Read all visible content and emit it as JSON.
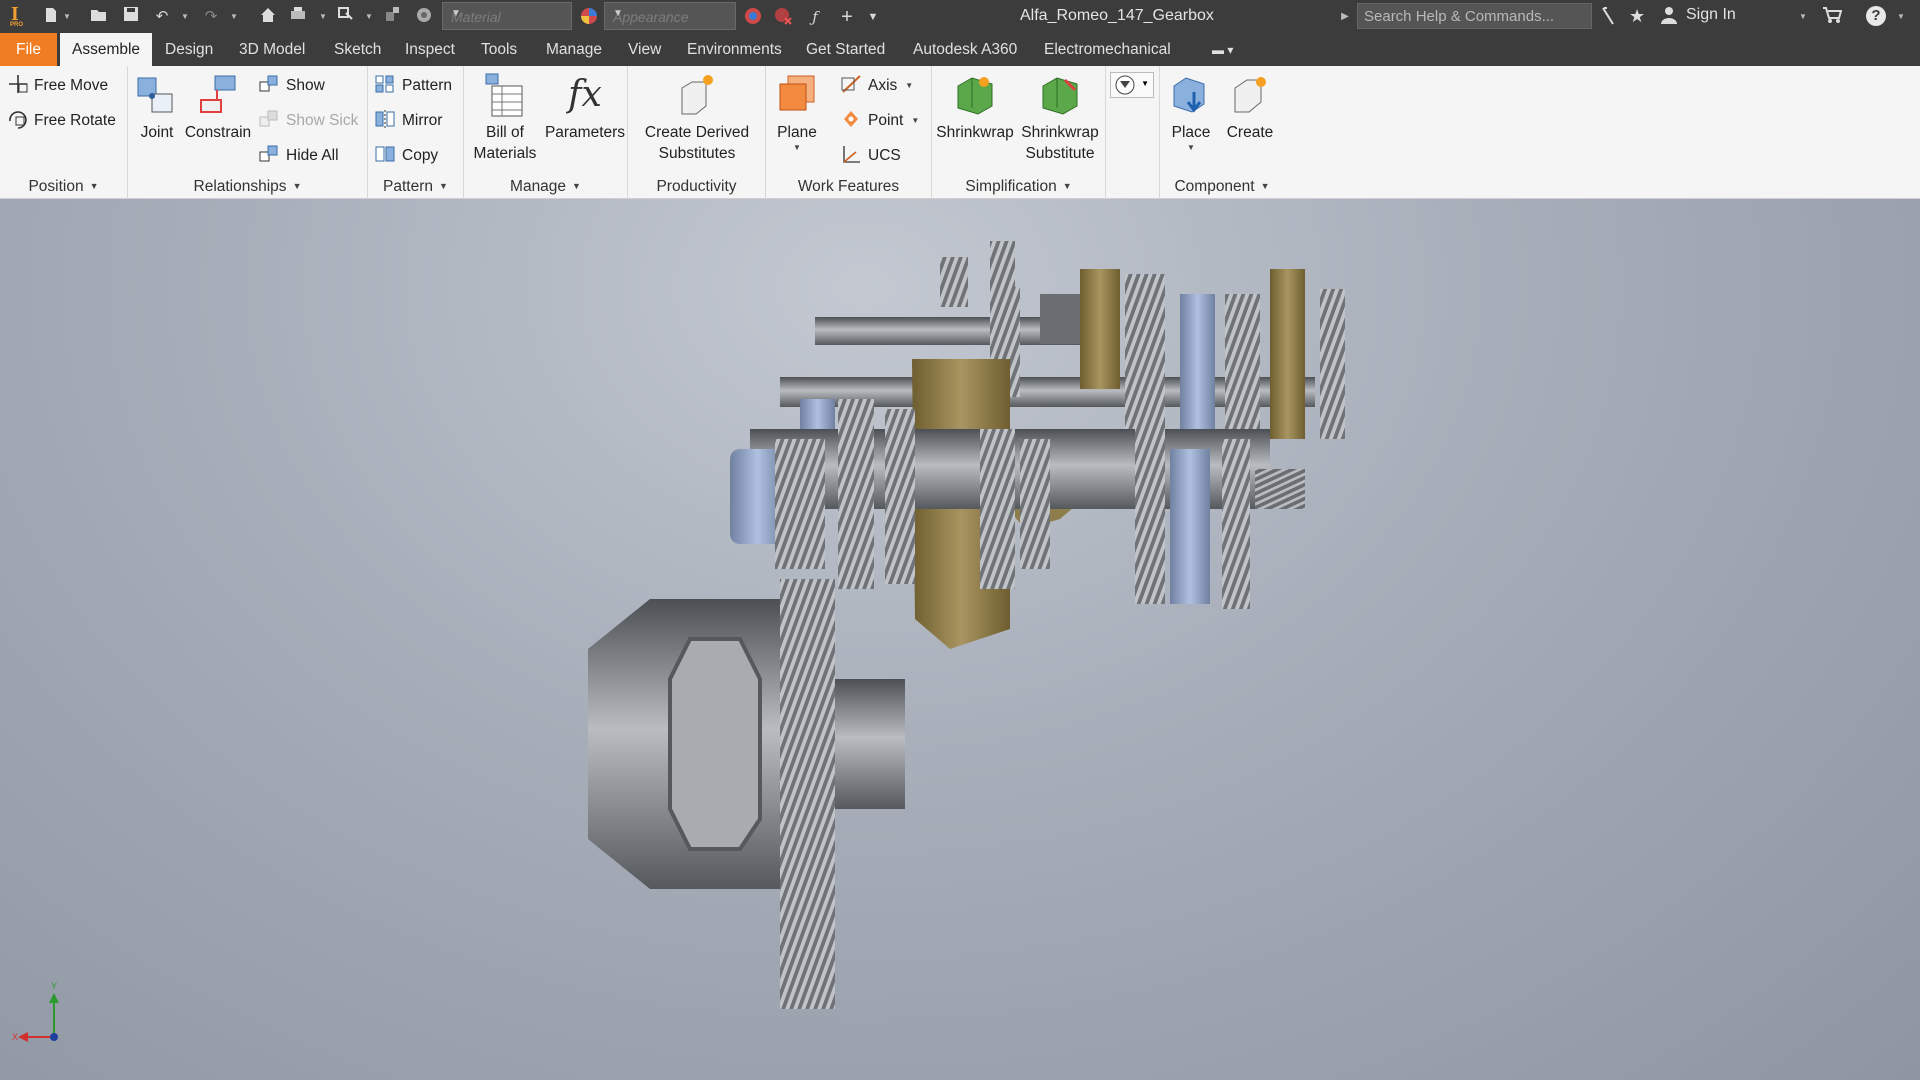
{
  "titlebar": {
    "logo_letter": "I",
    "logo_sub": "PRO",
    "material_placeholder": "Material",
    "appearance_placeholder": "Appearance",
    "document_title": "Alfa_Romeo_147_Gearbox",
    "search_placeholder": "Search Help & Commands...",
    "sign_in": "Sign In",
    "help_glyph": "?",
    "icons": [
      "new-icon",
      "open-icon",
      "save-icon",
      "undo-icon",
      "redo-icon",
      "home-icon",
      "print-icon",
      "select-icon",
      "appearance-icon",
      "material-icon",
      "parameters-icon",
      "measure-icon",
      "customize-icon",
      "cart-icon",
      "favorites-icon",
      "help-icon"
    ]
  },
  "tabs": {
    "file": "File",
    "items": [
      "Assemble",
      "Design",
      "3D Model",
      "Sketch",
      "Inspect",
      "Tools",
      "Manage",
      "View",
      "Environments",
      "Get Started",
      "Autodesk A360",
      "Electromechanical"
    ],
    "active": "Assemble"
  },
  "ribbon": {
    "position": {
      "title": "Position",
      "free_move": "Free Move",
      "free_rotate": "Free Rotate"
    },
    "relationships": {
      "title": "Relationships",
      "joint": "Joint",
      "constrain": "Constrain",
      "show": "Show",
      "show_sick": "Show Sick",
      "hide_all": "Hide All"
    },
    "pattern": {
      "title": "Pattern",
      "pattern": "Pattern",
      "mirror": "Mirror",
      "copy": "Copy"
    },
    "manage": {
      "title": "Manage",
      "bom_line1": "Bill of",
      "bom_line2": "Materials",
      "parameters": "Parameters",
      "fx_glyph": "fx"
    },
    "productivity": {
      "title": "Productivity",
      "cds_line1": "Create Derived",
      "cds_line2": "Substitutes"
    },
    "work_features": {
      "title": "Work Features",
      "plane": "Plane",
      "axis": "Axis",
      "point": "Point",
      "ucs": "UCS"
    },
    "simplification": {
      "title": "Simplification",
      "shrinkwrap": "Shrinkwrap",
      "sws_line1": "Shrinkwrap",
      "sws_line2": "Substitute"
    },
    "component": {
      "title": "Component",
      "place": "Place",
      "create": "Create"
    }
  },
  "viewport": {
    "triad_x": "X",
    "triad_y": "Y",
    "colors": {
      "gear": "#8a8d92",
      "housing": "#8c7a45",
      "bearing": "#8ea0c4"
    }
  }
}
